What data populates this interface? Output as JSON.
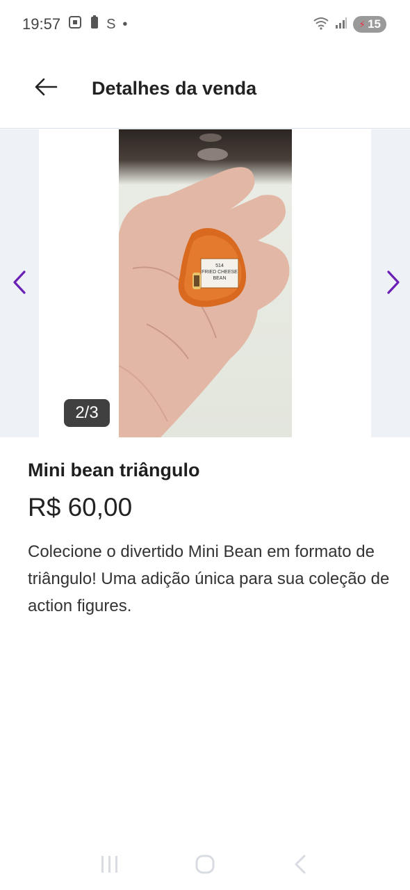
{
  "status_bar": {
    "time": "19:57",
    "left_icons": [
      "screenshot-icon",
      "battery-saver-icon",
      "s-icon",
      "dot-icon"
    ],
    "right_icons": [
      "wifi-icon",
      "signal-icon"
    ],
    "battery": "15"
  },
  "header": {
    "title": "Detalhes da venda"
  },
  "carousel": {
    "counter": "2/3",
    "image_label": {
      "line1": "514",
      "line2": "FRIED CHEESE",
      "line3": "BEAN"
    }
  },
  "product": {
    "title": "Mini bean triângulo",
    "price": "R$ 60,00",
    "description": "Colecione o divertido Mini Bean em formato de triângulo! Uma adição única para sua coleção de action figures."
  },
  "colors": {
    "accent": "#6a1fb5",
    "side_panel": "#eef1f5",
    "bean_orange": "#d8691f"
  }
}
